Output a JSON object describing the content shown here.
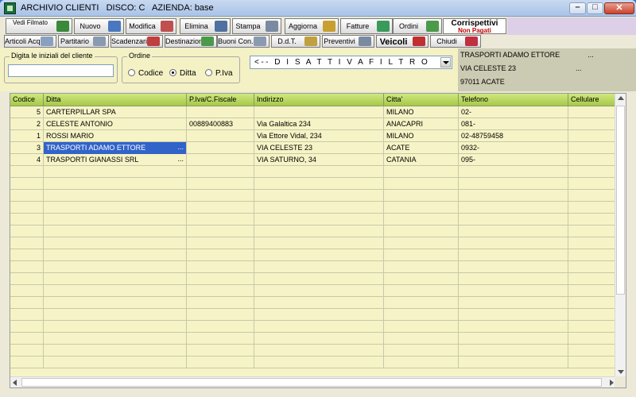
{
  "window": {
    "title": "ARCHIVIO CLIENTI   DISCO: C   AZIENDA: base",
    "min_glyph": "–",
    "max_glyph": "□",
    "close_glyph": "✕"
  },
  "toolbar1": [
    {
      "key": "vedi",
      "label": "Vedi Filmato",
      "icon": "film-icon",
      "color": "#3a8a3a"
    },
    {
      "key": "nuovo",
      "label": "Nuovo",
      "icon": "new-record-icon",
      "color": "#4a78c0"
    },
    {
      "key": "modifica",
      "label": "Modifica",
      "icon": "edit-icon",
      "color": "#c05050"
    },
    {
      "key": "elimina",
      "label": "Elimina",
      "icon": "delete-icon",
      "color": "#5070a0"
    },
    {
      "key": "stampa",
      "label": "Stampa",
      "icon": "printer-icon",
      "color": "#7a8aa0"
    },
    {
      "key": "aggiorna",
      "label": "Aggiorna",
      "icon": "refresh-icon",
      "color": "#c8a030"
    },
    {
      "key": "fatture",
      "label": "Fatture",
      "icon": "invoice-icon",
      "color": "#3a9a5a"
    },
    {
      "key": "ordini",
      "label": "Ordini",
      "icon": "orders-icon",
      "color": "#4a9a4a"
    }
  ],
  "corrispettivi": {
    "line1": "Corrispettivi",
    "line2": "Non Pagati"
  },
  "toolbar2": [
    {
      "key": "articoli",
      "label": "Articoli Acq.",
      "icon": "articles-icon",
      "color": "#8aa0c0"
    },
    {
      "key": "partitario",
      "label": "Partitario",
      "icon": "ledger-icon",
      "color": "#8a9ab0"
    },
    {
      "key": "scadenzario",
      "label": "Scadenzario",
      "icon": "calendar-icon",
      "color": "#c04040"
    },
    {
      "key": "destinazioni",
      "label": "Destinazioni",
      "icon": "destinations-icon",
      "color": "#4a9a4a"
    },
    {
      "key": "buoni",
      "label": "Buoni Con.",
      "icon": "vouchers-icon",
      "color": "#8a9ab0"
    },
    {
      "key": "ddt",
      "label": "D.d.T.",
      "icon": "ddt-icon",
      "color": "#c0a040"
    },
    {
      "key": "preventivi",
      "label": "Preventivi",
      "icon": "quote-icon",
      "color": "#7a8aa0"
    },
    {
      "key": "veicoli",
      "label": "Veicoli",
      "icon": "car-icon",
      "color": "#c03030"
    },
    {
      "key": "chiudi",
      "label": "Chiudi",
      "icon": "exit-icon",
      "color": "#c03040"
    }
  ],
  "search": {
    "caption": "Digita le iniziali del cliente",
    "value": "",
    "placeholder": ""
  },
  "order": {
    "caption": "Ordine",
    "options": [
      {
        "label": "Codice",
        "selected": false
      },
      {
        "label": "Ditta",
        "selected": true
      },
      {
        "label": "P.Iva",
        "selected": false
      }
    ]
  },
  "filter": {
    "value": "<-- D I S A T T I V A   F I L T R O"
  },
  "selected_customer": {
    "line1": "TRASPORTI ADAMO ETTORE              ...",
    "line2": "VIA CELESTE 23                              ...",
    "line3": "97011 ACATE"
  },
  "grid": {
    "columns": [
      "Codice",
      "Ditta",
      "P.Iva/C.Fiscale",
      "Indirizzo",
      "Citta'",
      "Telefono",
      "Cellulare"
    ],
    "rows": [
      {
        "codice": "5",
        "ditta": "CARTERPILLAR SPA",
        "piva": "",
        "indirizzo": "",
        "citta": "MILANO",
        "telefono": "02-",
        "cellulare": "",
        "selected": false,
        "more": ""
      },
      {
        "codice": "2",
        "ditta": "CELESTE ANTONIO",
        "piva": "00889400883",
        "indirizzo": "Via Galaltica 234",
        "citta": "ANACAPRI",
        "telefono": "081-",
        "cellulare": "",
        "selected": false,
        "more": ""
      },
      {
        "codice": "1",
        "ditta": "ROSSI MARIO",
        "piva": "",
        "indirizzo": "Via Ettore Vidal, 234",
        "citta": "MILANO",
        "telefono": "02-48759458",
        "cellulare": "",
        "selected": false,
        "more": ""
      },
      {
        "codice": "3",
        "ditta": "TRASPORTI ADAMO ETTORE",
        "piva": "",
        "indirizzo": "VIA CELESTE 23",
        "citta": "ACATE",
        "telefono": "0932-",
        "cellulare": "",
        "selected": true,
        "more": "..."
      },
      {
        "codice": "4",
        "ditta": "TRASPORTI GIANASSI SRL",
        "piva": "",
        "indirizzo": "VIA SATURNO, 34",
        "citta": "CATANIA",
        "telefono": "095-",
        "cellulare": "",
        "selected": false,
        "more": "..."
      }
    ]
  }
}
